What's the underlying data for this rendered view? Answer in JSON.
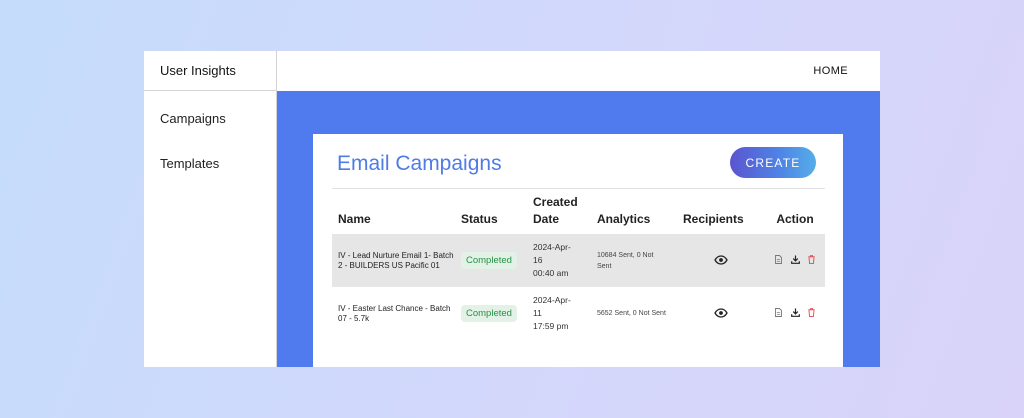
{
  "sidebar": {
    "title": "User Insights",
    "items": [
      {
        "label": "Campaigns"
      },
      {
        "label": "Templates"
      }
    ]
  },
  "topbar": {
    "home_label": "HOME"
  },
  "card": {
    "title": "Email Campaigns",
    "create_label": "CREATE"
  },
  "table": {
    "headers": {
      "name": "Name",
      "status": "Status",
      "created_line1": "Created",
      "created_line2": "Date",
      "analytics": "Analytics",
      "recipients": "Recipients",
      "action": "Action"
    },
    "rows": [
      {
        "name": "IV - Lead Nurture Email 1- Batch 2 - BUILDERS US Pacific 01",
        "status": "Completed",
        "date_line1": "2024-Apr-",
        "date_line2": "16",
        "date_line3": "00:40 am",
        "analytics_line1": "10684 Sent, 0 Not",
        "analytics_line2": "Sent"
      },
      {
        "name": "IV - Easter Last Chance - Batch 07 - 5.7k",
        "status": "Completed",
        "date_line1": "2024-Apr-",
        "date_line2": "11",
        "date_line3": "17:59 pm",
        "analytics_line1": "5652 Sent, 0 Not Sent",
        "analytics_line2": ""
      }
    ]
  },
  "icons": {
    "view": "eye-icon",
    "copy": "document-copy-icon",
    "download": "download-icon",
    "delete": "trash-icon"
  },
  "colors": {
    "main_bg": "#507bef",
    "title": "#4f7be8",
    "badge_bg": "#e3f2e7",
    "badge_text": "#279146",
    "delete": "#e0444a"
  }
}
